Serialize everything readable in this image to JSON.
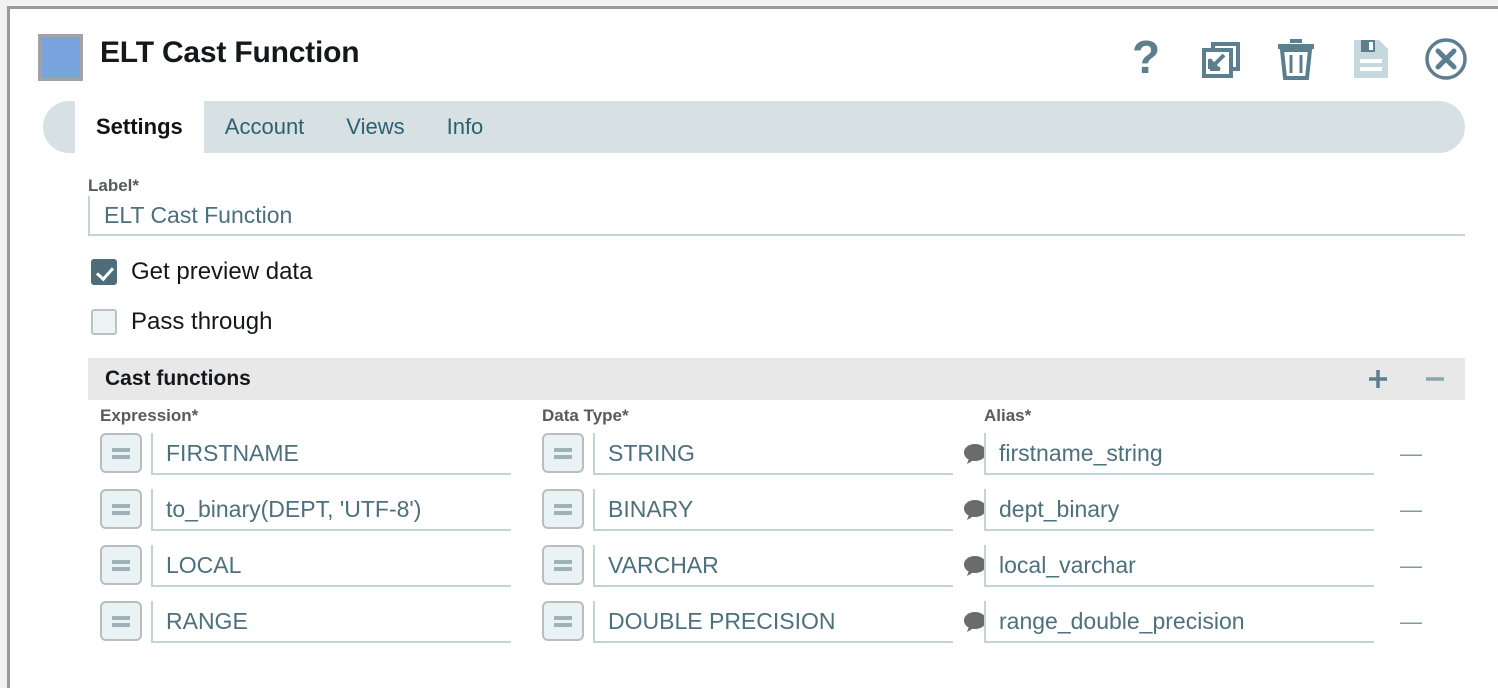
{
  "window": {
    "title": "ELT Cast Function",
    "icon": "component-square-icon",
    "accent_color": "#7aa4dd",
    "toolbar": [
      {
        "name": "help-icon",
        "label": "?"
      },
      {
        "name": "restore-window-icon",
        "label": ""
      },
      {
        "name": "delete-icon",
        "label": ""
      },
      {
        "name": "save-icon",
        "label": ""
      },
      {
        "name": "close-icon",
        "label": ""
      }
    ]
  },
  "tabs": [
    {
      "label": "Settings",
      "active": true
    },
    {
      "label": "Account",
      "active": false
    },
    {
      "label": "Views",
      "active": false
    },
    {
      "label": "Info",
      "active": false
    }
  ],
  "form": {
    "label_field": {
      "label": "Label*",
      "value": "ELT Cast Function",
      "placeholder": "Label"
    },
    "checkboxes": [
      {
        "label": "Get preview data",
        "checked": true
      },
      {
        "label": "Pass through",
        "checked": false
      }
    ]
  },
  "section": {
    "title": "Cast functions",
    "add_label": "+",
    "remove_label": "−"
  },
  "grid": {
    "columns": [
      "Expression*",
      "Data Type*",
      "Alias*"
    ],
    "row_remove_label": "—",
    "rows": [
      {
        "expression": "FIRSTNAME",
        "data_type": "STRING",
        "alias": "firstname_string"
      },
      {
        "expression": "to_binary(DEPT, 'UTF-8')",
        "data_type": "BINARY",
        "alias": "dept_binary"
      },
      {
        "expression": "LOCAL",
        "data_type": "VARCHAR",
        "alias": "local_varchar"
      },
      {
        "expression": "RANGE",
        "data_type": "DOUBLE PRECISION",
        "alias": "range_double_precision"
      }
    ]
  },
  "colors": {
    "tabbar": "#d7e1e4",
    "section_header": "#e8e8e8",
    "input_text": "#4c707d",
    "icon": "#5b7f8e",
    "checkbox_checked": "#4e6c79"
  }
}
